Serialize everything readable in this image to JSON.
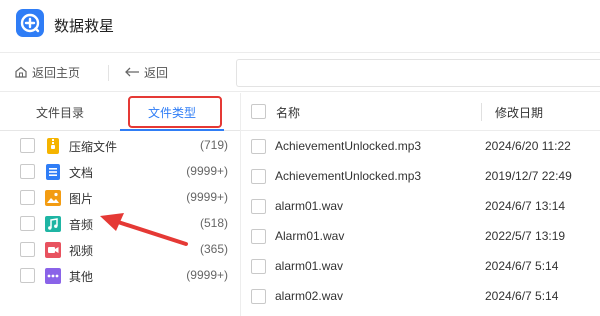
{
  "app": {
    "title": "数据救星"
  },
  "toolbar": {
    "home_label": "返回主页",
    "back_label": "返回"
  },
  "tabs": [
    {
      "label": "文件目录"
    },
    {
      "label": "文件类型"
    }
  ],
  "types": [
    {
      "label": "压缩文件",
      "count": "(719)",
      "icon": "archive-icon",
      "color": "#f5b400"
    },
    {
      "label": "文档",
      "count": "(9999+)",
      "icon": "document-icon",
      "color": "#2f7df6"
    },
    {
      "label": "图片",
      "count": "(9999+)",
      "icon": "image-icon",
      "color": "#f39c12"
    },
    {
      "label": "音频",
      "count": "(518)",
      "icon": "music-icon",
      "color": "#1fb5a4"
    },
    {
      "label": "视频",
      "count": "(365)",
      "icon": "video-icon",
      "color": "#e8525f"
    },
    {
      "label": "其他",
      "count": "(9999+)",
      "icon": "more-icon",
      "color": "#8a63e8"
    }
  ],
  "table": {
    "columns": [
      "名称",
      "修改日期"
    ],
    "rows": [
      {
        "name": "AchievementUnlocked.mp3",
        "date": "2024/6/20 11:22"
      },
      {
        "name": "AchievementUnlocked.mp3",
        "date": "2019/12/7 22:49"
      },
      {
        "name": "alarm01.wav",
        "date": "2024/6/7 13:14"
      },
      {
        "name": "Alarm01.wav",
        "date": "2022/5/7 13:19"
      },
      {
        "name": "alarm01.wav",
        "date": "2024/6/7 5:14"
      },
      {
        "name": "alarm02.wav",
        "date": "2024/6/7 5:14"
      }
    ]
  },
  "colors": {
    "accent": "#2f7df6",
    "highlight": "#e53935"
  }
}
